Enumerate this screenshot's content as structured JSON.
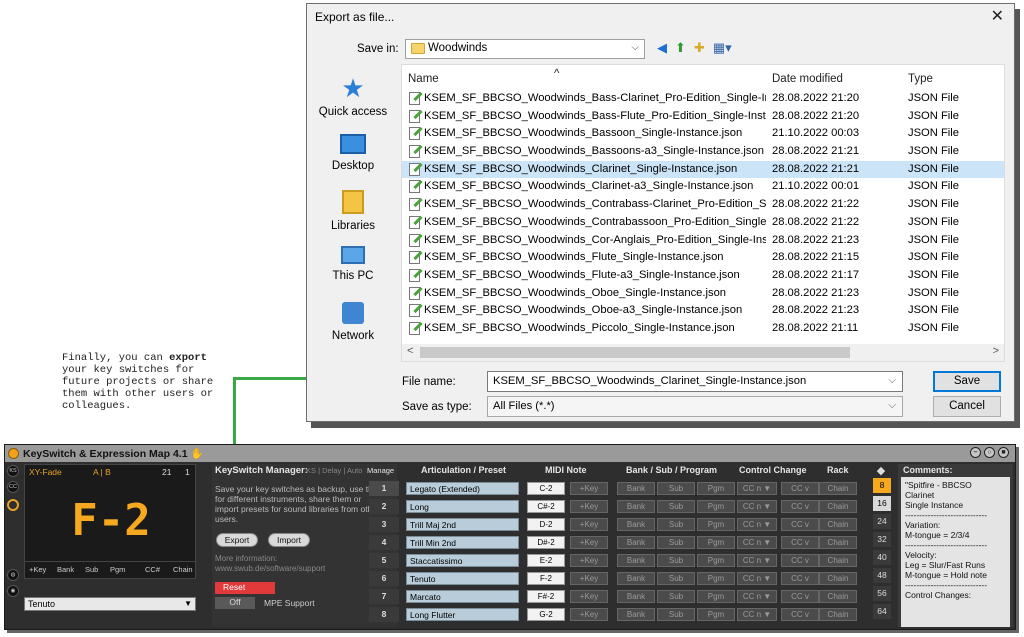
{
  "annotation": {
    "pre": "Finally, you can ",
    "bold": "export",
    "post": " your key switches for future projects or share them with other users or colleagues."
  },
  "dialog": {
    "title": "Export as file...",
    "close": "✕",
    "save_in_label": "Save in:",
    "save_in_value": "Woodwinds",
    "places": [
      "Quick access",
      "Desktop",
      "Libraries",
      "This PC",
      "Network"
    ],
    "columns": [
      "Name",
      "Date modified",
      "Type"
    ],
    "files": [
      {
        "name": "KSEM_SF_BBCSO_Woodwinds_Bass-Clarinet_Pro-Edition_Single-Ins...",
        "date": "28.08.2022 21:20",
        "type": "JSON File"
      },
      {
        "name": "KSEM_SF_BBCSO_Woodwinds_Bass-Flute_Pro-Edition_Single-Insta...",
        "date": "28.08.2022 21:20",
        "type": "JSON File"
      },
      {
        "name": "KSEM_SF_BBCSO_Woodwinds_Bassoon_Single-Instance.json",
        "date": "21.10.2022 00:03",
        "type": "JSON File"
      },
      {
        "name": "KSEM_SF_BBCSO_Woodwinds_Bassoons-a3_Single-Instance.json",
        "date": "28.08.2022 21:21",
        "type": "JSON File"
      },
      {
        "name": "KSEM_SF_BBCSO_Woodwinds_Clarinet_Single-Instance.json",
        "date": "28.08.2022 21:21",
        "type": "JSON File"
      },
      {
        "name": "KSEM_SF_BBCSO_Woodwinds_Clarinet-a3_Single-Instance.json",
        "date": "21.10.2022 00:01",
        "type": "JSON File"
      },
      {
        "name": "KSEM_SF_BBCSO_Woodwinds_Contrabass-Clarinet_Pro-Edition_Sin...",
        "date": "28.08.2022 21:22",
        "type": "JSON File"
      },
      {
        "name": "KSEM_SF_BBCSO_Woodwinds_Contrabassoon_Pro-Edition_Single-I...",
        "date": "28.08.2022 21:22",
        "type": "JSON File"
      },
      {
        "name": "KSEM_SF_BBCSO_Woodwinds_Cor-Anglais_Pro-Edition_Single-Inst...",
        "date": "28.08.2022 21:23",
        "type": "JSON File"
      },
      {
        "name": "KSEM_SF_BBCSO_Woodwinds_Flute_Single-Instance.json",
        "date": "28.08.2022 21:15",
        "type": "JSON File"
      },
      {
        "name": "KSEM_SF_BBCSO_Woodwinds_Flute-a3_Single-Instance.json",
        "date": "28.08.2022 21:17",
        "type": "JSON File"
      },
      {
        "name": "KSEM_SF_BBCSO_Woodwinds_Oboe_Single-Instance.json",
        "date": "28.08.2022 21:23",
        "type": "JSON File"
      },
      {
        "name": "KSEM_SF_BBCSO_Woodwinds_Oboe-a3_Single-Instance.json",
        "date": "28.08.2022 21:23",
        "type": "JSON File"
      },
      {
        "name": "KSEM_SF_BBCSO_Woodwinds_Piccolo_Single-Instance.json",
        "date": "28.08.2022 21:11",
        "type": "JSON File"
      }
    ],
    "selected_index": 4,
    "file_name_label": "File name:",
    "file_name_value": "KSEM_SF_BBCSO_Woodwinds_Clarinet_Single-Instance.json",
    "type_label": "Save as type:",
    "type_value": "All Files (*.*)",
    "save_label": "Save",
    "cancel_label": "Cancel"
  },
  "device": {
    "title": "KeySwitch & Expression Map 4.1",
    "display": {
      "xy": "XY-Fade",
      "ab": "A | B",
      "n21": "21",
      "n1": "1",
      "note": "F-2",
      "labels": [
        "+Key",
        "Bank",
        "Sub",
        "Pgm",
        "CC#",
        "Chain"
      ]
    },
    "preset": "Tenuto",
    "manager": {
      "title": "KeySwitch Manager:",
      "tabs": "KS | Delay | Auto",
      "manage": "Manage",
      "desc": "Save your key switches as backup, use them for different instruments, share them or import presets for sound libraries from other users.",
      "export": "Export",
      "import": "Import",
      "info_title": "More information:",
      "info_url": "www.swub.de/software/support",
      "reset": "Reset",
      "off": "Off",
      "mpe": "MPE Support"
    },
    "headers": {
      "articulation": "Articulation / Preset",
      "midi": "MIDI Note",
      "bank": "Bank / Sub / Program",
      "cc": "Control Change",
      "rack": "Rack"
    },
    "cell_labels": {
      "key": "+Key",
      "bank": "Bank",
      "sub": "Sub",
      "pgm": "Pgm",
      "ccn": "CC n ▼",
      "ccv": "CC v",
      "chain": "Chain"
    },
    "rows": [
      {
        "idx": "1",
        "name": "Legato (Extended)",
        "note": "C-2",
        "vel": "8"
      },
      {
        "idx": "2",
        "name": "Long",
        "note": "C#-2",
        "vel": "16"
      },
      {
        "idx": "3",
        "name": "Trill Maj 2nd",
        "note": "D-2",
        "vel": "24"
      },
      {
        "idx": "4",
        "name": "Trill Min 2nd",
        "note": "D#-2",
        "vel": "32"
      },
      {
        "idx": "5",
        "name": "Staccatissimo",
        "note": "E-2",
        "vel": "40"
      },
      {
        "idx": "6",
        "name": "Tenuto",
        "note": "F-2",
        "vel": "48"
      },
      {
        "idx": "7",
        "name": "Marcato",
        "note": "F#-2",
        "vel": "56"
      },
      {
        "idx": "8",
        "name": "Long Flutter",
        "note": "G-2",
        "vel": "64"
      }
    ],
    "comments_title": "Comments:",
    "comments": "\"Spitfire - BBCSO\nClarinet\nSingle Instance\n-----------------------------\nVariation:\nM-tongue = 2/3/4\n-----------------------------\nVelocity:\nLeg = Slur/Fast Runs\nM-tongue = Hold note\n-----------------------------\nControl Changes:"
  }
}
